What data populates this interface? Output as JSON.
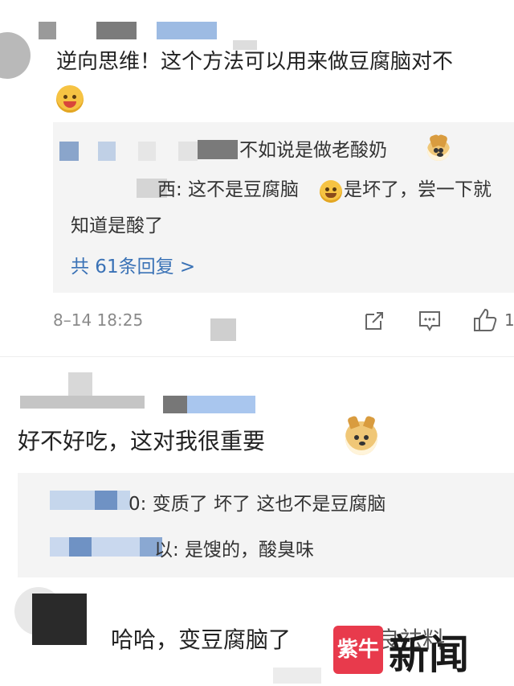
{
  "comment1": {
    "text_line1": "逆向思维！这个方法可以用来做豆腐脑对不",
    "emoji": "blush-emoji",
    "replies": [
      {
        "text": "不如说是做老酸奶"
      },
      {
        "text": "西: 这不是豆腐脑"
      },
      {
        "text_after_emoji": "是坏了，尝一下就"
      },
      {
        "text": "知道是酸了"
      }
    ],
    "more_replies": "共 61条回复 >",
    "timestamp": "8–14 18:25",
    "like_count": "1"
  },
  "comment2": {
    "text": "好不好吃，这对我很重要",
    "replies": [
      {
        "text": "0: 变质了  坏了  这也不是豆腐脑"
      },
      {
        "text": "以: 是馊的，酸臭味"
      }
    ]
  },
  "comment3": {
    "text": "哈哈，变豆腐脑了",
    "text_tail": "改良祛料"
  },
  "watermark": {
    "badge": "紫牛",
    "label": "新闻",
    "color": "#e83a4c"
  }
}
